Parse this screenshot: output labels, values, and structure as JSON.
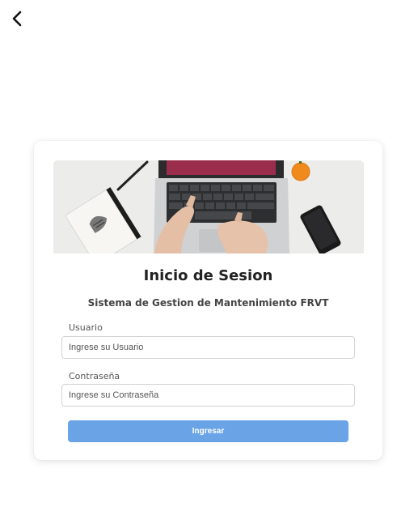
{
  "nav": {
    "back_icon": "chevron-left-icon"
  },
  "login": {
    "hero_image": "laptop-typing-photo",
    "title": "Inicio de Sesion",
    "subtitle": "Sistema de Gestion de Mantenimiento FRVT",
    "username": {
      "label": "Usuario",
      "placeholder": "Ingrese su Usuario",
      "value": ""
    },
    "password": {
      "label": "Contraseña",
      "placeholder": "Ingrese su Contraseña",
      "value": ""
    },
    "submit_label": "Ingresar",
    "colors": {
      "button": "#6aa4e6",
      "button_text": "#ffffff"
    }
  }
}
